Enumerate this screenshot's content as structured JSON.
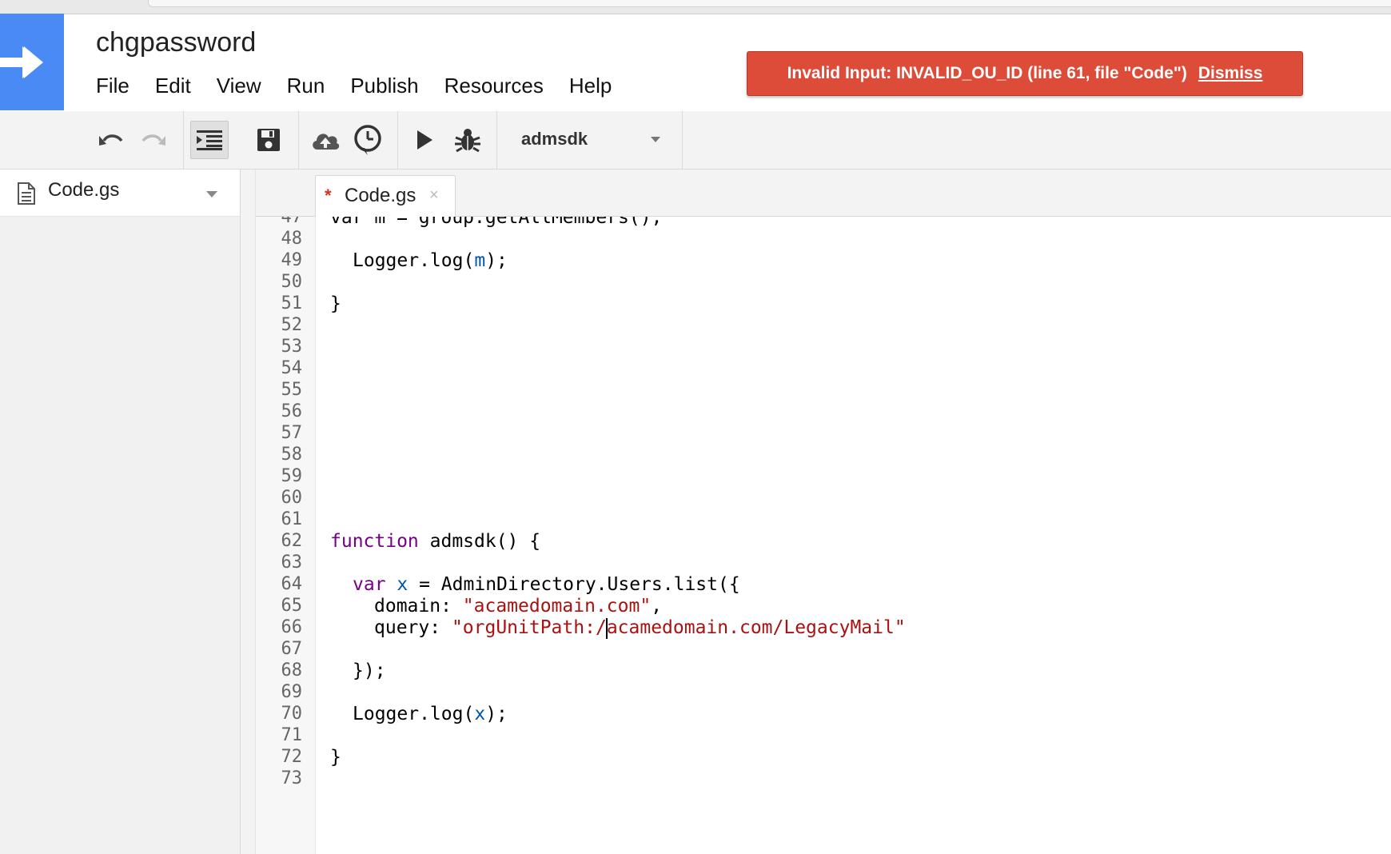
{
  "app": {
    "title": "chgpassword",
    "menu": [
      "File",
      "Edit",
      "View",
      "Run",
      "Publish",
      "Resources",
      "Help"
    ]
  },
  "error": {
    "message": "Invalid Input: INVALID_OU_ID (line 61, file \"Code\")",
    "dismiss_label": "Dismiss",
    "color": "#dd4b39"
  },
  "toolbar": {
    "icons": [
      "undo-icon",
      "redo-icon",
      "indent-icon",
      "save-icon",
      "publish-cloud-icon",
      "triggers-clock-icon",
      "run-icon",
      "debug-bug-icon"
    ],
    "function_select": "admsdk"
  },
  "sidebar": {
    "file_name": "Code.gs"
  },
  "editor": {
    "tab_label": "Code.gs",
    "modified_marker": "*",
    "close_glyph": "×",
    "partial_line": "var m = group.getAllMembers();",
    "line_numbers": [
      "48",
      "49",
      "50",
      "51",
      "52",
      "53",
      "54",
      "55",
      "56",
      "57",
      "58",
      "59",
      "60",
      "61",
      "62",
      "63",
      "64",
      "65",
      "66",
      "67",
      "68",
      "69",
      "70",
      "71",
      "72",
      "73"
    ],
    "code": {
      "l49_a": "Logger.log(",
      "l49_var": "m",
      "l49_b": ");",
      "l51": "}",
      "l62_kw": "function",
      "l62_rest": " admsdk() {",
      "l64_kw": "var",
      "l64_var": "x",
      "l64_rest": " = AdminDirectory.Users.list({",
      "l65_key": "domain: ",
      "l65_str": "\"acamedomain.com\"",
      "l65_tail": ",",
      "l66_key": "query: ",
      "l66_str_a": "\"orgUnitPath:/",
      "l66_str_b": "acamedomain.com/LegacyMail\"",
      "l68": "});",
      "l70_a": "Logger.log(",
      "l70_var": "x",
      "l70_b": ");",
      "l72": "}"
    }
  },
  "colors": {
    "brand_blue": "#4a8af4",
    "keyword": "#770088",
    "variable": "#0055aa",
    "string": "#aa1111"
  }
}
